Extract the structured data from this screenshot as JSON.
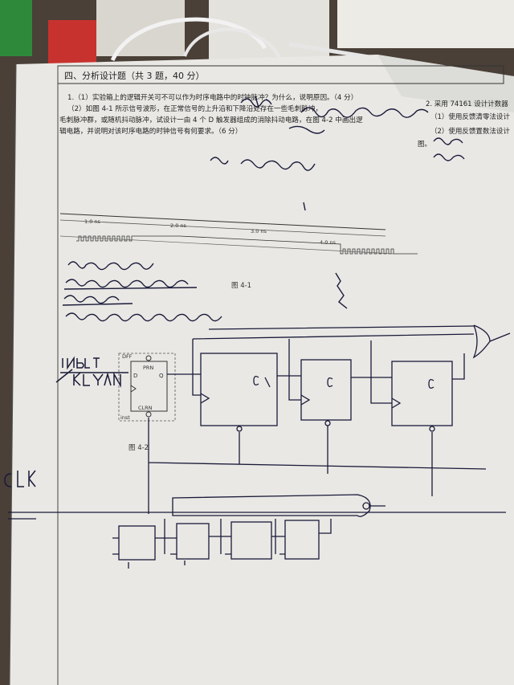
{
  "header": {
    "section_title": "四、分析设计题（共 3 题，40 分）",
    "q1_line1": "1.（1）实验箱上的逻辑开关可不可以作为时序电路中的时钟脉冲？为什么，说明原因。（4 分）",
    "q1_line2": "（2）如图 4-1 所示信号波形，在正常信号的上升沿和下降沿处存在一些毛刺脉冲，",
    "q1_line3": "毛刺脉冲群，或随机抖动脉冲，试设计一由 4 个 D 触发器组成的消除抖动电路，在图 4-2 中画出逻",
    "q1_line4": "辑电路，并说明对该时序电路的时钟信号有何要求。（6 分）",
    "right_q2": "2. 采用 74161 设计计数器",
    "right_q2_1": "（1）使用反馈清零法设计",
    "right_q2_2": "（2）使用反馈置数法设计",
    "right_fig": "图。"
  },
  "figure1": {
    "label": "图 4-1",
    "time_labels": [
      "1.0 ns",
      "2.0 ns",
      "3.0 ns",
      "4.0 ns"
    ]
  },
  "figure2": {
    "label": "图 4-2",
    "dff_title": "DFF",
    "prn": "PRN",
    "clrn": "CLRN",
    "inst": "inst",
    "d_pin": "D",
    "q_pin": "Q"
  }
}
